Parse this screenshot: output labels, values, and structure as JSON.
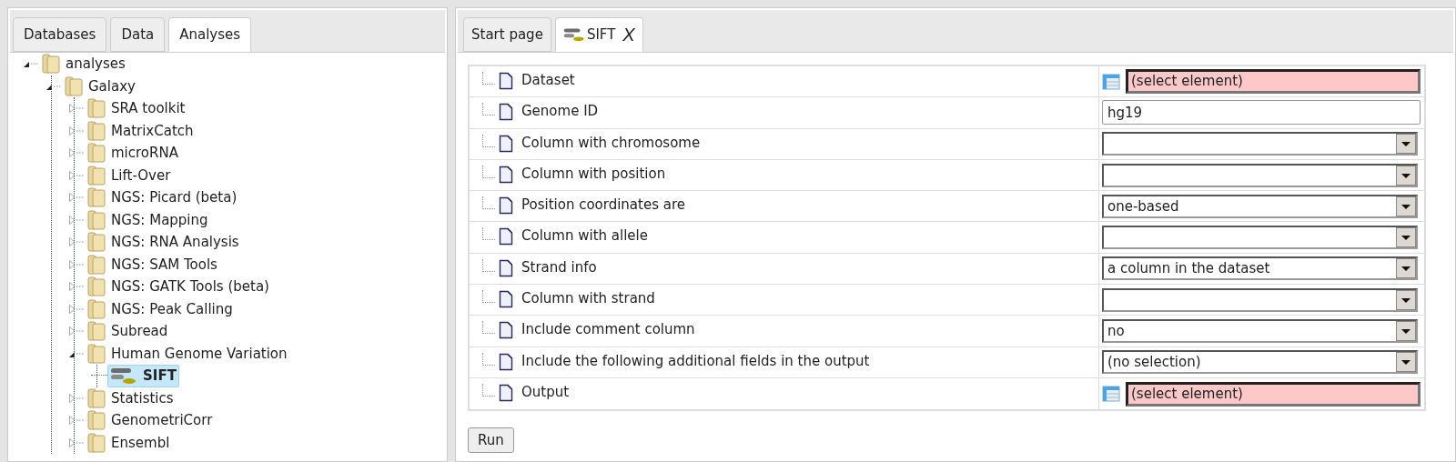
{
  "left_tabs": [
    {
      "label": "Databases",
      "selected": false
    },
    {
      "label": "Data",
      "selected": false
    },
    {
      "label": "Analyses",
      "selected": true
    }
  ],
  "tree": [
    {
      "label": "analyses",
      "kind": "folder",
      "expanded": true,
      "selected": false,
      "children": [
        {
          "label": "Galaxy",
          "kind": "folder",
          "expanded": true,
          "selected": false,
          "children": [
            {
              "label": "SRA toolkit",
              "kind": "folder",
              "expanded": false,
              "selected": false
            },
            {
              "label": "MatrixCatch",
              "kind": "folder",
              "expanded": false,
              "selected": false
            },
            {
              "label": "microRNA",
              "kind": "folder",
              "expanded": false,
              "selected": false
            },
            {
              "label": "Lift-Over",
              "kind": "folder",
              "expanded": false,
              "selected": false
            },
            {
              "label": "NGS: Picard (beta)",
              "kind": "folder",
              "expanded": false,
              "selected": false
            },
            {
              "label": "NGS: Mapping",
              "kind": "folder",
              "expanded": false,
              "selected": false
            },
            {
              "label": "NGS: RNA Analysis",
              "kind": "folder",
              "expanded": false,
              "selected": false
            },
            {
              "label": "NGS: SAM Tools",
              "kind": "folder",
              "expanded": false,
              "selected": false
            },
            {
              "label": "NGS: GATK Tools (beta)",
              "kind": "folder",
              "expanded": false,
              "selected": false
            },
            {
              "label": "NGS: Peak Calling",
              "kind": "folder",
              "expanded": false,
              "selected": false
            },
            {
              "label": "Subread",
              "kind": "folder",
              "expanded": false,
              "selected": false
            },
            {
              "label": "Human Genome Variation",
              "kind": "folder",
              "expanded": true,
              "selected": false,
              "children": [
                {
                  "label": "SIFT",
                  "kind": "tool",
                  "selected": true
                }
              ]
            },
            {
              "label": "Statistics",
              "kind": "folder",
              "expanded": false,
              "selected": false
            },
            {
              "label": "GenometriCorr",
              "kind": "folder",
              "expanded": false,
              "selected": false
            },
            {
              "label": "Ensembl",
              "kind": "folder",
              "expanded": false,
              "selected": false
            }
          ]
        }
      ]
    }
  ],
  "right_tabs": [
    {
      "label": "Start page",
      "kind": "plain",
      "selected": false
    },
    {
      "label": "SIFT",
      "kind": "tool",
      "close": "X",
      "selected": true
    }
  ],
  "form": [
    {
      "label": "Dataset",
      "kind": "element",
      "value": "(select element)"
    },
    {
      "label": "Genome ID",
      "kind": "text",
      "value": "hg19"
    },
    {
      "label": "Column with chromosome",
      "kind": "dropdown"
    },
    {
      "label": "Column with position",
      "kind": "dropdown"
    },
    {
      "label": "Position coordinates are",
      "kind": "dropdown",
      "value": "one-based"
    },
    {
      "label": "Column with allele",
      "kind": "dropdown"
    },
    {
      "label": "Strand info",
      "kind": "dropdown",
      "value": "a column in the dataset"
    },
    {
      "label": "Column with strand",
      "kind": "dropdown"
    },
    {
      "label": "Include comment column",
      "kind": "dropdown",
      "value": "no"
    },
    {
      "label": "Include the following additional fields in the output",
      "kind": "dropdown",
      "value": "(no selection)"
    },
    {
      "label": "Output",
      "kind": "element",
      "value": "(select element)"
    }
  ],
  "run_button": "Run"
}
